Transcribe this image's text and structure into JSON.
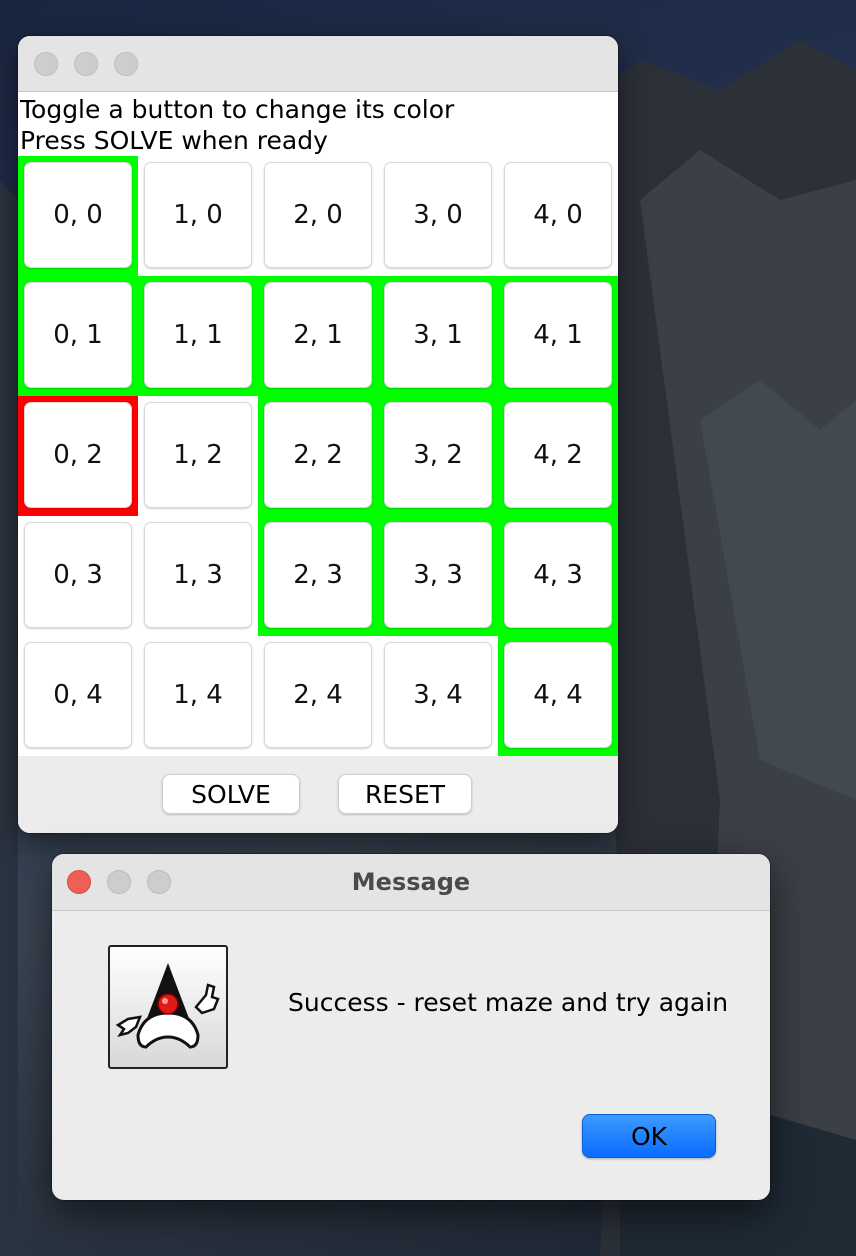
{
  "maze_window": {
    "instructions": [
      "Toggle a button to change its color",
      "Press SOLVE when ready"
    ],
    "grid": [
      [
        {
          "label": "0, 0",
          "color": "green"
        },
        {
          "label": "1, 0",
          "color": "white"
        },
        {
          "label": "2, 0",
          "color": "white"
        },
        {
          "label": "3, 0",
          "color": "white"
        },
        {
          "label": "4, 0",
          "color": "white"
        }
      ],
      [
        {
          "label": "0, 1",
          "color": "green"
        },
        {
          "label": "1, 1",
          "color": "green"
        },
        {
          "label": "2, 1",
          "color": "green"
        },
        {
          "label": "3, 1",
          "color": "green"
        },
        {
          "label": "4, 1",
          "color": "green"
        }
      ],
      [
        {
          "label": "0, 2",
          "color": "red"
        },
        {
          "label": "1, 2",
          "color": "white"
        },
        {
          "label": "2, 2",
          "color": "green"
        },
        {
          "label": "3, 2",
          "color": "green"
        },
        {
          "label": "4, 2",
          "color": "green"
        }
      ],
      [
        {
          "label": "0, 3",
          "color": "white"
        },
        {
          "label": "1, 3",
          "color": "white"
        },
        {
          "label": "2, 3",
          "color": "green"
        },
        {
          "label": "3, 3",
          "color": "green"
        },
        {
          "label": "4, 3",
          "color": "green"
        }
      ],
      [
        {
          "label": "0, 4",
          "color": "white"
        },
        {
          "label": "1, 4",
          "color": "white"
        },
        {
          "label": "2, 4",
          "color": "white"
        },
        {
          "label": "3, 4",
          "color": "white"
        },
        {
          "label": "4, 4",
          "color": "green"
        }
      ]
    ],
    "solve_label": "SOLVE",
    "reset_label": "RESET"
  },
  "message_dialog": {
    "title": "Message",
    "icon": "java-duke-icon",
    "text": "Success - reset maze and try again",
    "ok_label": "OK"
  },
  "colors": {
    "green": "#00ff00",
    "red": "#ff0000",
    "white": "#ffffff",
    "ok_button": "#1a7cff",
    "close_button": "#ee5f57"
  }
}
